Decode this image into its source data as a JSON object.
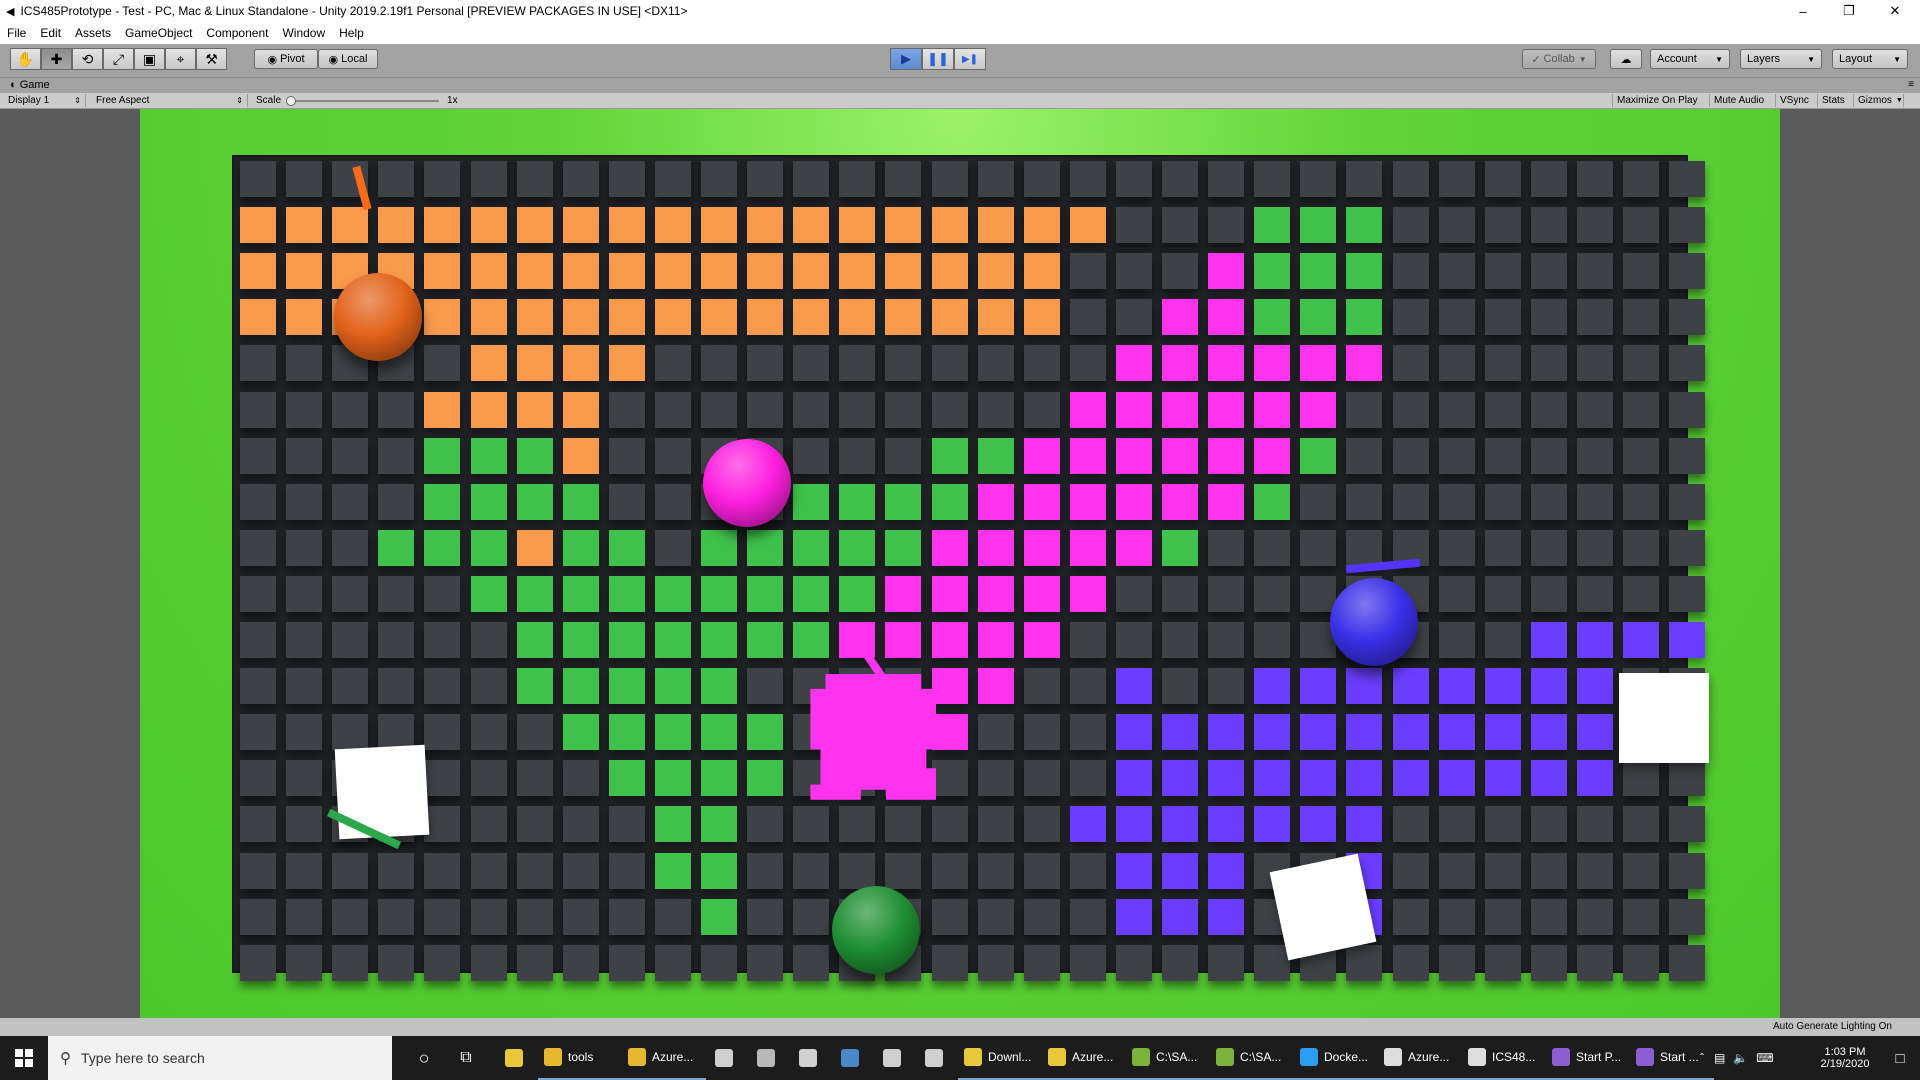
{
  "window": {
    "title": "ICS485Prototype - Test - PC, Mac & Linux Standalone - Unity 2019.2.19f1 Personal [PREVIEW PACKAGES IN USE] <DX11>",
    "minimize": "–",
    "maximize": "❐",
    "close": "✕"
  },
  "menu": [
    "File",
    "Edit",
    "Assets",
    "GameObject",
    "Component",
    "Window",
    "Help"
  ],
  "toolbar": {
    "tools": [
      "hand-tool-icon",
      "move-tool-icon",
      "rotate-tool-icon",
      "scale-tool-icon",
      "rect-tool-icon",
      "transform-tool-icon",
      "custom-tool-icon"
    ],
    "tool_glyphs": [
      "✋",
      "✚",
      "⟲",
      "⤢",
      "▣",
      "⌖",
      "⚒"
    ],
    "pivot": "Pivot",
    "local": "Local",
    "play_glyph": "▶",
    "pause_glyph": "❚❚",
    "step_glyph": "▶❚",
    "collab": "Collab",
    "cloud_glyph": "☁",
    "account": "Account",
    "layers": "Layers",
    "layout": "Layout"
  },
  "game_tab": {
    "label": "Game",
    "display": "Display 1",
    "aspect": "Free Aspect",
    "scale_label": "Scale",
    "scale_value": "1x",
    "maximize_on_play": "Maximize On Play",
    "mute_audio": "Mute Audio",
    "vsync": "VSync",
    "stats": "Stats",
    "gizmos": "Gizmos"
  },
  "colors": {
    "orange": "#f99a4c",
    "green": "#3fc24c",
    "magenta": "#ff33ee",
    "purple": "#6a3dff",
    "neutral": "#3e4146",
    "lime": "#4cc72c"
  },
  "grid": {
    "cols": 32,
    "rows": 18,
    "cells": {
      "orange": [
        [
          1,
          0
        ],
        [
          1,
          1
        ],
        [
          1,
          2
        ],
        [
          1,
          3
        ],
        [
          1,
          4
        ],
        [
          1,
          5
        ],
        [
          1,
          6
        ],
        [
          1,
          7
        ],
        [
          1,
          8
        ],
        [
          1,
          9
        ],
        [
          1,
          10
        ],
        [
          1,
          11
        ],
        [
          1,
          12
        ],
        [
          1,
          13
        ],
        [
          1,
          14
        ],
        [
          1,
          15
        ],
        [
          1,
          16
        ],
        [
          1,
          17
        ],
        [
          1,
          18
        ],
        [
          2,
          0
        ],
        [
          2,
          1
        ],
        [
          2,
          2
        ],
        [
          2,
          3
        ],
        [
          2,
          4
        ],
        [
          2,
          5
        ],
        [
          2,
          6
        ],
        [
          2,
          7
        ],
        [
          2,
          8
        ],
        [
          2,
          9
        ],
        [
          2,
          10
        ],
        [
          2,
          11
        ],
        [
          2,
          12
        ],
        [
          2,
          13
        ],
        [
          2,
          14
        ],
        [
          2,
          15
        ],
        [
          2,
          16
        ],
        [
          2,
          17
        ],
        [
          3,
          0
        ],
        [
          3,
          1
        ],
        [
          3,
          2
        ],
        [
          3,
          3
        ],
        [
          3,
          4
        ],
        [
          3,
          5
        ],
        [
          3,
          6
        ],
        [
          3,
          7
        ],
        [
          3,
          8
        ],
        [
          3,
          9
        ],
        [
          3,
          10
        ],
        [
          3,
          11
        ],
        [
          3,
          12
        ],
        [
          3,
          13
        ],
        [
          3,
          14
        ],
        [
          3,
          15
        ],
        [
          3,
          16
        ],
        [
          3,
          17
        ],
        [
          4,
          5
        ],
        [
          4,
          6
        ],
        [
          4,
          7
        ],
        [
          4,
          8
        ],
        [
          5,
          4
        ],
        [
          5,
          5
        ],
        [
          5,
          6
        ],
        [
          5,
          7
        ],
        [
          6,
          7
        ],
        [
          8,
          6
        ]
      ],
      "green": [
        [
          1,
          22
        ],
        [
          1,
          23
        ],
        [
          1,
          24
        ],
        [
          2,
          22
        ],
        [
          2,
          23
        ],
        [
          2,
          24
        ],
        [
          3,
          22
        ],
        [
          3,
          23
        ],
        [
          3,
          24
        ],
        [
          6,
          4
        ],
        [
          6,
          5
        ],
        [
          6,
          6
        ],
        [
          6,
          15
        ],
        [
          6,
          16
        ],
        [
          6,
          23
        ],
        [
          7,
          4
        ],
        [
          7,
          5
        ],
        [
          7,
          6
        ],
        [
          7,
          7
        ],
        [
          7,
          12
        ],
        [
          7,
          13
        ],
        [
          7,
          14
        ],
        [
          7,
          15
        ],
        [
          7,
          22
        ],
        [
          8,
          3
        ],
        [
          8,
          4
        ],
        [
          8,
          5
        ],
        [
          8,
          7
        ],
        [
          8,
          8
        ],
        [
          8,
          10
        ],
        [
          8,
          11
        ],
        [
          8,
          12
        ],
        [
          8,
          13
        ],
        [
          8,
          14
        ],
        [
          8,
          20
        ],
        [
          9,
          5
        ],
        [
          9,
          6
        ],
        [
          9,
          7
        ],
        [
          9,
          8
        ],
        [
          9,
          9
        ],
        [
          9,
          10
        ],
        [
          9,
          11
        ],
        [
          9,
          12
        ],
        [
          9,
          13
        ],
        [
          10,
          6
        ],
        [
          10,
          7
        ],
        [
          10,
          8
        ],
        [
          10,
          9
        ],
        [
          10,
          10
        ],
        [
          10,
          11
        ],
        [
          10,
          12
        ],
        [
          11,
          6
        ],
        [
          11,
          7
        ],
        [
          11,
          8
        ],
        [
          11,
          9
        ],
        [
          11,
          10
        ],
        [
          12,
          7
        ],
        [
          12,
          8
        ],
        [
          12,
          9
        ],
        [
          12,
          10
        ],
        [
          12,
          11
        ],
        [
          13,
          8
        ],
        [
          13,
          9
        ],
        [
          13,
          10
        ],
        [
          13,
          11
        ],
        [
          14,
          9
        ],
        [
          14,
          10
        ],
        [
          15,
          9
        ],
        [
          15,
          10
        ],
        [
          16,
          10
        ]
      ],
      "magenta": [
        [
          2,
          21
        ],
        [
          3,
          20
        ],
        [
          3,
          21
        ],
        [
          4,
          19
        ],
        [
          4,
          20
        ],
        [
          4,
          21
        ],
        [
          4,
          22
        ],
        [
          4,
          23
        ],
        [
          4,
          24
        ],
        [
          5,
          18
        ],
        [
          5,
          19
        ],
        [
          5,
          20
        ],
        [
          5,
          21
        ],
        [
          5,
          22
        ],
        [
          5,
          23
        ],
        [
          6,
          17
        ],
        [
          6,
          18
        ],
        [
          6,
          19
        ],
        [
          6,
          20
        ],
        [
          6,
          21
        ],
        [
          6,
          22
        ],
        [
          7,
          16
        ],
        [
          7,
          17
        ],
        [
          7,
          18
        ],
        [
          7,
          19
        ],
        [
          7,
          20
        ],
        [
          7,
          21
        ],
        [
          8,
          15
        ],
        [
          8,
          16
        ],
        [
          8,
          17
        ],
        [
          8,
          18
        ],
        [
          8,
          19
        ],
        [
          9,
          14
        ],
        [
          9,
          15
        ],
        [
          9,
          16
        ],
        [
          9,
          17
        ],
        [
          9,
          18
        ],
        [
          10,
          13
        ],
        [
          10,
          14
        ],
        [
          10,
          15
        ],
        [
          10,
          16
        ],
        [
          10,
          17
        ],
        [
          11,
          15
        ],
        [
          11,
          16
        ],
        [
          12,
          15
        ]
      ],
      "purple": [
        [
          10,
          28
        ],
        [
          10,
          29
        ],
        [
          10,
          30
        ],
        [
          10,
          31
        ],
        [
          11,
          19
        ],
        [
          11,
          22
        ],
        [
          11,
          23
        ],
        [
          11,
          24
        ],
        [
          11,
          25
        ],
        [
          11,
          26
        ],
        [
          11,
          27
        ],
        [
          11,
          28
        ],
        [
          11,
          29
        ],
        [
          12,
          19
        ],
        [
          12,
          20
        ],
        [
          12,
          21
        ],
        [
          12,
          22
        ],
        [
          12,
          23
        ],
        [
          12,
          24
        ],
        [
          12,
          25
        ],
        [
          12,
          26
        ],
        [
          12,
          27
        ],
        [
          12,
          28
        ],
        [
          12,
          29
        ],
        [
          13,
          19
        ],
        [
          13,
          20
        ],
        [
          13,
          21
        ],
        [
          13,
          22
        ],
        [
          13,
          23
        ],
        [
          13,
          24
        ],
        [
          13,
          25
        ],
        [
          13,
          26
        ],
        [
          13,
          27
        ],
        [
          13,
          28
        ],
        [
          13,
          29
        ],
        [
          14,
          18
        ],
        [
          14,
          19
        ],
        [
          14,
          20
        ],
        [
          14,
          21
        ],
        [
          14,
          22
        ],
        [
          14,
          23
        ],
        [
          14,
          24
        ],
        [
          15,
          19
        ],
        [
          15,
          20
        ],
        [
          15,
          21
        ],
        [
          15,
          24
        ],
        [
          16,
          19
        ],
        [
          16,
          20
        ],
        [
          16,
          21
        ],
        [
          16,
          24
        ]
      ]
    }
  },
  "objects": [
    {
      "type": "ball",
      "name": "orange-ball",
      "color": "#e2621a",
      "row": 3,
      "col": 2.6
    },
    {
      "type": "ball",
      "name": "magenta-ball",
      "color": "#ff1fe0",
      "row": 6.6,
      "col": 10.6
    },
    {
      "type": "ball",
      "name": "purple-ball",
      "color": "#3a2fe8",
      "row": 9.6,
      "col": 24.2
    },
    {
      "type": "ball",
      "name": "green-ball",
      "color": "#1f8f33",
      "row": 16.3,
      "col": 13.4
    },
    {
      "type": "square",
      "name": "white-block",
      "row": 13.3,
      "col": 2.7,
      "rotation": -3
    },
    {
      "type": "square",
      "name": "white-block",
      "row": 11.7,
      "col": 30.5,
      "rotation": 0
    },
    {
      "type": "square",
      "name": "white-block",
      "row": 15.8,
      "col": 23.1,
      "rotation": -12
    },
    {
      "type": "paddle",
      "name": "orange-paddle",
      "color": "#ff6a1a",
      "row": 0.2,
      "col": 2.25,
      "rotation": 75,
      "length": 44
    },
    {
      "type": "paddle",
      "name": "purple-paddle",
      "color": "#5533ff",
      "row": 8.4,
      "col": 24.4,
      "rotation": -5,
      "length": 74
    },
    {
      "type": "paddle",
      "name": "green-paddle",
      "color": "#2aa84a",
      "row": 14.1,
      "col": 2.3,
      "rotation": 25,
      "length": 78
    },
    {
      "type": "paddle",
      "name": "magenta-paddle",
      "color": "#ff33ee",
      "row": 10.6,
      "col": 13.4,
      "rotation": 55,
      "length": 46
    },
    {
      "type": "blob",
      "name": "magenta-splat",
      "color": "#ff33ee",
      "row": 12.1,
      "col": 13.35
    }
  ],
  "status": {
    "lighting": "Auto Generate Lighting On"
  },
  "taskbar": {
    "search_placeholder": "Type here to search",
    "items": [
      {
        "label": "",
        "color": "#e8c83a",
        "icon": "chrome-icon"
      },
      {
        "label": "tools",
        "color": "#e6b830",
        "icon": "folder-icon"
      },
      {
        "label": "Azure...",
        "color": "#e6b830",
        "icon": "folder-icon"
      },
      {
        "label": "",
        "color": "#cfcfcf",
        "icon": "store-icon"
      },
      {
        "label": "",
        "color": "#b9b9b9",
        "icon": "paint-icon"
      },
      {
        "label": "",
        "color": "#cfcfcf",
        "icon": "settings-icon"
      },
      {
        "label": "",
        "color": "#4a88c8",
        "icon": "steam-icon"
      },
      {
        "label": "",
        "color": "#cfcfcf",
        "icon": "unity-hub-icon"
      },
      {
        "label": "",
        "color": "#cfcfcf",
        "icon": "vs-code-icon"
      },
      {
        "label": "Downl...",
        "color": "#e8c83a",
        "icon": "chrome-icon"
      },
      {
        "label": "Azure...",
        "color": "#e8c83a",
        "icon": "chrome-icon"
      },
      {
        "label": "C:\\SA...",
        "color": "#7bb33a",
        "icon": "terminal-icon"
      },
      {
        "label": "C:\\SA...",
        "color": "#7bb33a",
        "icon": "terminal-icon"
      },
      {
        "label": "Docke...",
        "color": "#2a9df0",
        "icon": "docker-icon"
      },
      {
        "label": "Azure...",
        "color": "#dddddd",
        "icon": "unity-icon"
      },
      {
        "label": "ICS48...",
        "color": "#dddddd",
        "icon": "unity-icon"
      },
      {
        "label": "Start P...",
        "color": "#8b5fd1",
        "icon": "visual-studio-icon"
      },
      {
        "label": "Start ...",
        "color": "#8b5fd1",
        "icon": "visual-studio-icon"
      }
    ],
    "time": "1:03 PM",
    "date": "2/19/2020"
  }
}
